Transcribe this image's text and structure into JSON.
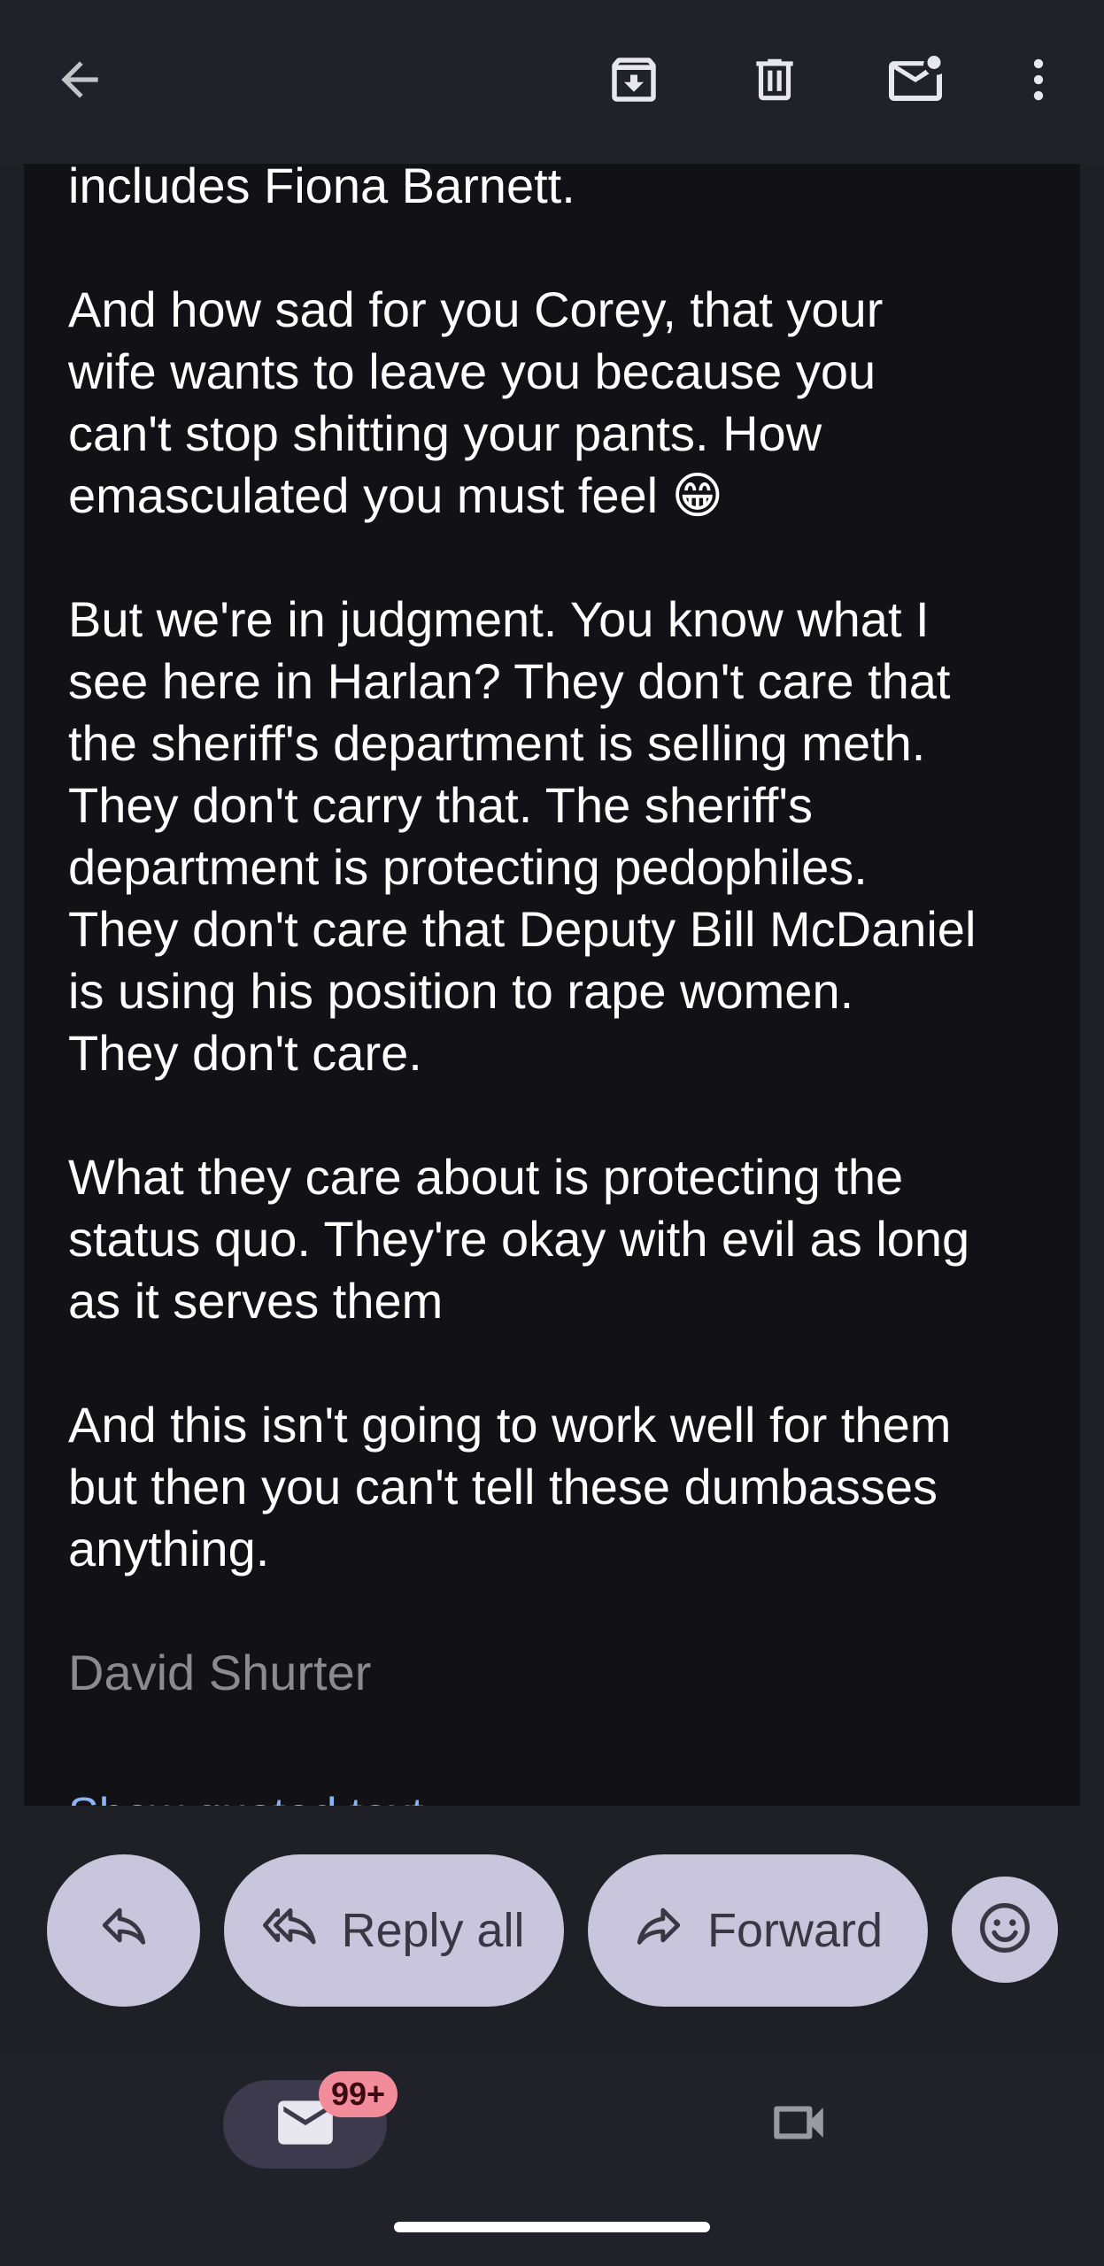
{
  "message": {
    "paragraphs": [
      {
        "lines": [
          "includes Fiona Barnett."
        ]
      },
      {
        "lines": [
          "And how sad for you Corey, that your",
          "wife wants to leave you because you",
          "can't stop shitting your pants. How",
          "emasculated you must feel 😁"
        ]
      },
      {
        "lines": [
          "But we're in judgment. You know what I",
          "see here in Harlan? They don't care that",
          "the sheriff's department is selling meth.",
          "They don't carry that. The sheriff's",
          "department is protecting pedophiles.",
          "They don't care that Deputy Bill McDaniel",
          "is using his position to rape women.",
          "They don't care."
        ]
      },
      {
        "lines": [
          "What they care about is protecting the",
          "status quo. They're okay with evil as long",
          "as it serves them"
        ]
      },
      {
        "lines": [
          "And this isn't going to work well for them",
          "but then you can't tell these dumbasses",
          "anything."
        ]
      }
    ],
    "signature": "David Shurter",
    "quoted_link": "Show quoted text"
  },
  "actions": {
    "reply_all_label": "Reply all",
    "forward_label": "Forward"
  },
  "nav": {
    "mail_badge": "99+"
  },
  "colors": {
    "card_bg": "#111116",
    "pill_bg": "#c9c5dc",
    "badge_bg": "#f28b9a",
    "link": "#8ab4f8"
  },
  "icons": {
    "back": "arrow-back-icon",
    "archive": "archive-icon",
    "delete": "trash-icon",
    "mark_unread": "mail-unread-icon",
    "more": "more-vert-icon",
    "reply": "reply-icon",
    "reply_all": "reply-all-icon",
    "forward": "forward-icon",
    "emoji": "emoji-icon",
    "mail": "mail-icon",
    "video": "video-icon"
  }
}
